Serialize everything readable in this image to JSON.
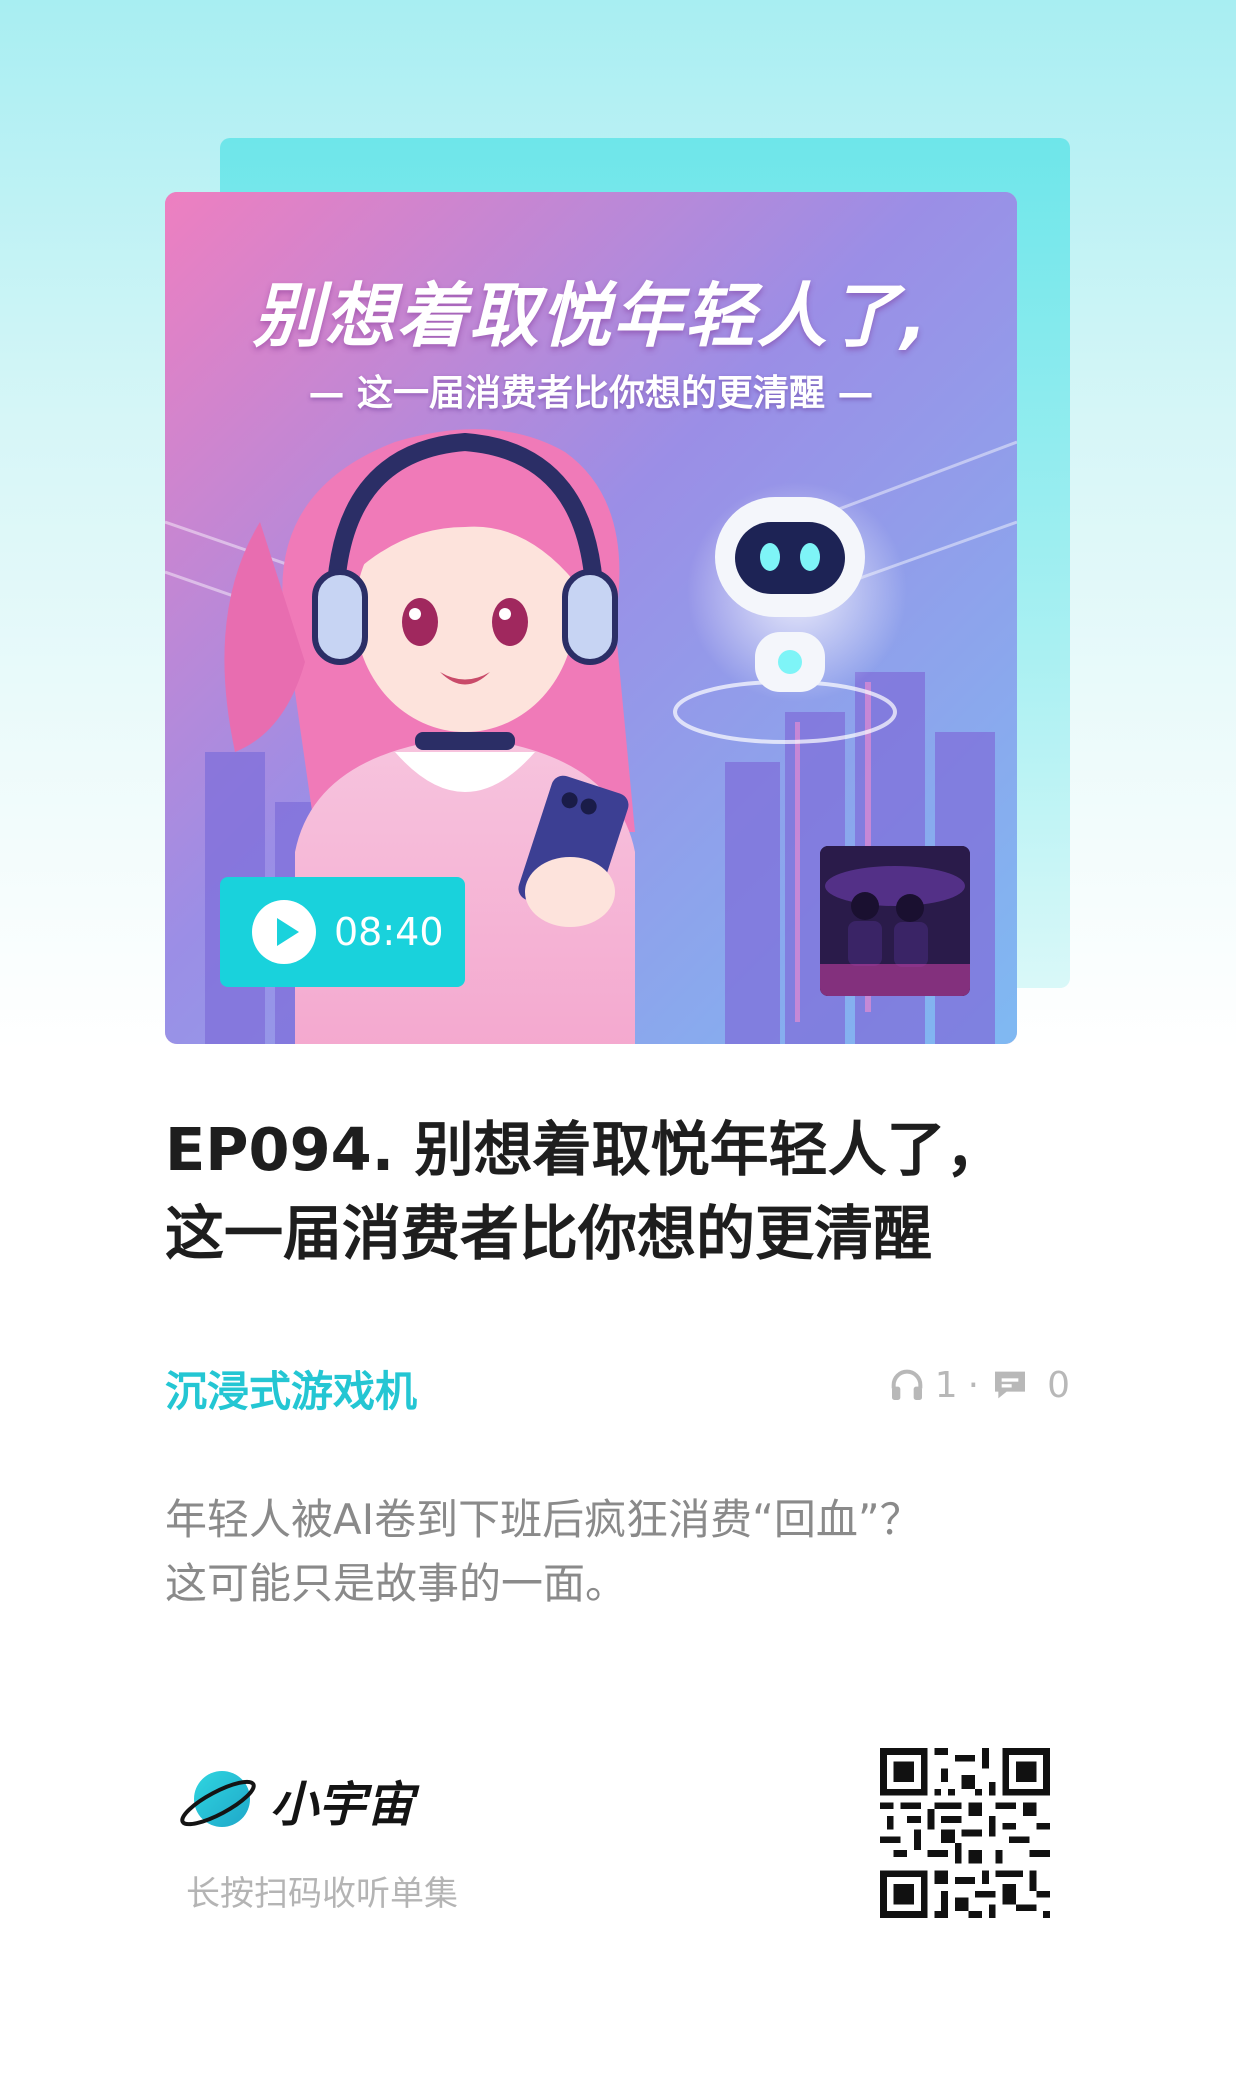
{
  "cover": {
    "title": "别想着取悦年轻人了,",
    "subtitle": "— 这一届消费者比你想的更清醒 —",
    "duration": "08:40"
  },
  "episode": {
    "title": "EP094. 别想着取悦年轻人了，这一届消费者比你想的更清醒"
  },
  "channel": {
    "name": "沉浸式游戏机"
  },
  "stats": {
    "listens": "1",
    "separator": "·",
    "comments": "0",
    "listen_icon": "headphones-icon",
    "comment_icon": "comment-icon"
  },
  "description": {
    "line1": "年轻人被AI卷到下班后疯狂消费“回血”？",
    "line2": "这可能只是故事的一面。"
  },
  "brand": {
    "name": "小宇宙",
    "hint": "长按扫码收听单集",
    "logo_icon": "planet-logo-icon"
  },
  "colors": {
    "accent": "#19d2dc",
    "channel": "#24c6d3",
    "title": "#1e1e1e",
    "muted": "#8a8a8a"
  }
}
